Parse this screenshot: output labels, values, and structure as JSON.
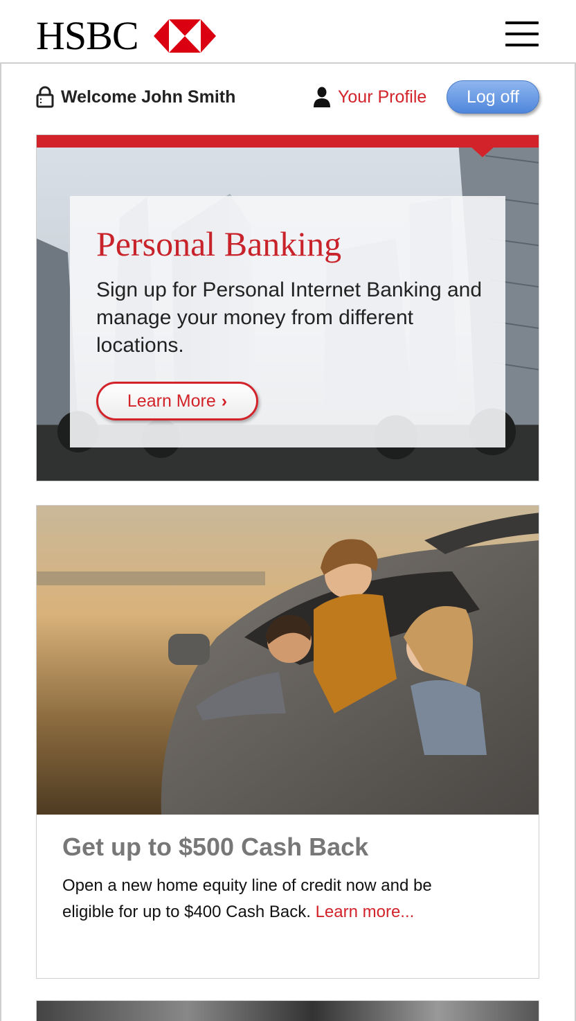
{
  "header": {
    "logo_text": "HSBC",
    "menu_icon": "hamburger-menu-icon"
  },
  "welcome": {
    "text": "Welcome John Smith",
    "profile_label": "Your Profile",
    "logoff_label": "Log off"
  },
  "hero": {
    "title": "Personal Banking",
    "description": "Sign up for Personal Internet Banking and manage your money from different locations.",
    "button_label": "Learn More",
    "button_chevron": "›"
  },
  "promo": {
    "title": "Get up to $500 Cash Back",
    "description": "Open a new home equity line of credit now and be eligible for up to $400 Cash Back. ",
    "link_label": "Learn more..."
  },
  "colors": {
    "brand_red": "#d2232a",
    "logoff_blue": "#5a8ee0"
  }
}
